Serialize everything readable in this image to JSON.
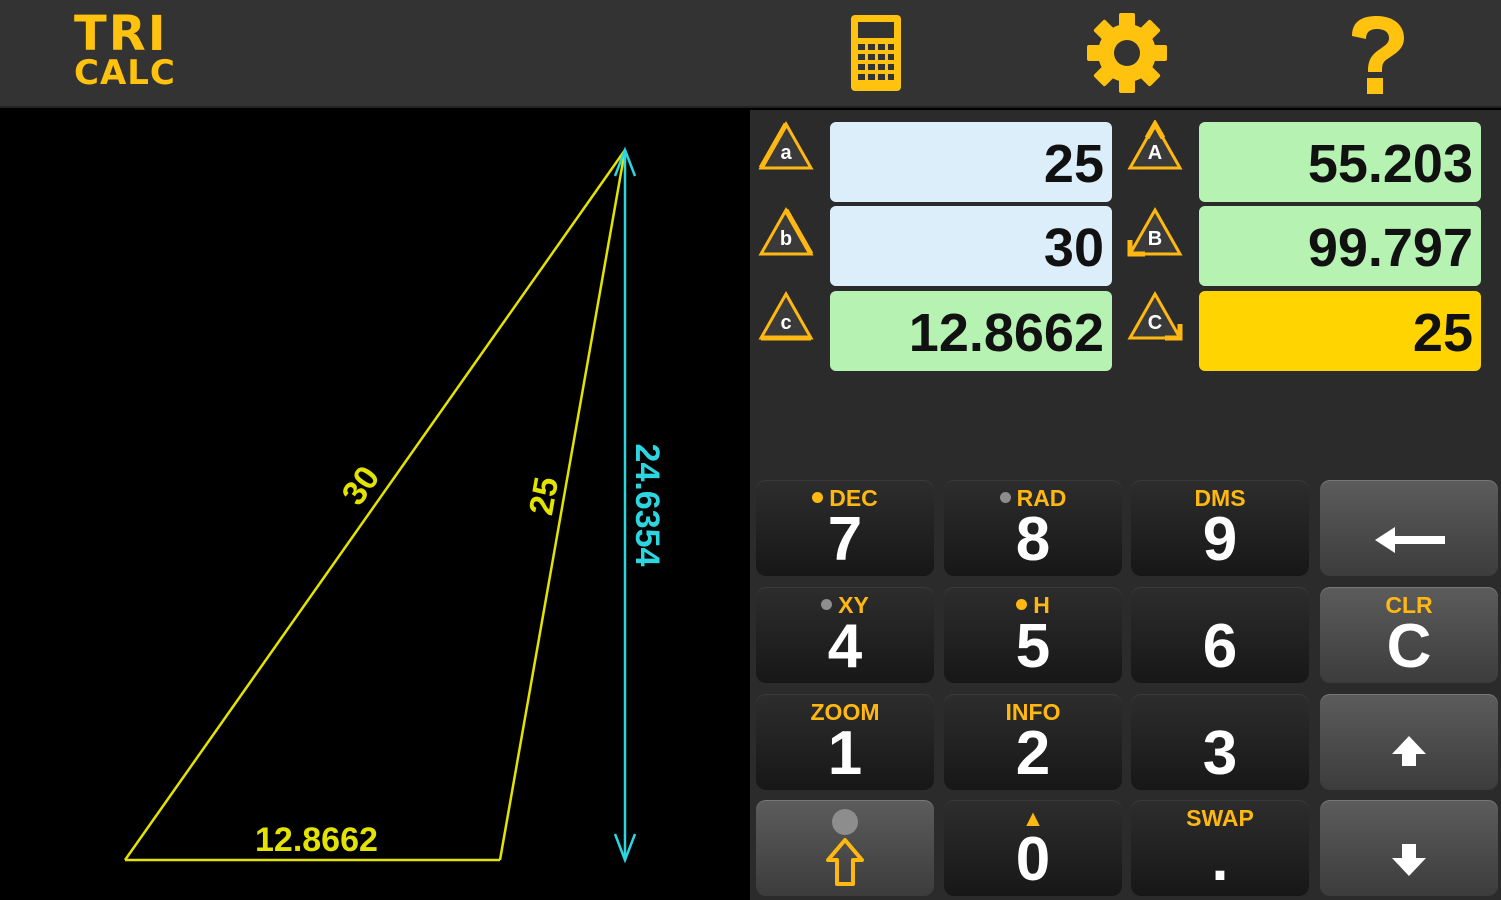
{
  "app": {
    "logo_line1": "TRI",
    "logo_line2": "CALC",
    "accent": "#FFC20E",
    "toolbar": {
      "calculator_icon": "calculator-icon",
      "settings_icon": "gear-icon",
      "help_icon": "question-mark-icon"
    }
  },
  "drawing": {
    "side_a_label": "25",
    "side_b_label": "30",
    "side_c_label": "12.8662",
    "height_label": "24.6354",
    "line_color": "#E3E300",
    "height_color": "#2BD6E0"
  },
  "fields": {
    "a": {
      "label": "a",
      "value": "25"
    },
    "b": {
      "label": "b",
      "value": "30"
    },
    "c": {
      "label": "c",
      "value": "12.8662"
    },
    "A": {
      "label": "A",
      "value": "55.203"
    },
    "B": {
      "label": "B",
      "value": "99.797"
    },
    "C": {
      "label": "C",
      "value": "25"
    },
    "colors": {
      "input": "#DCEEFA",
      "computed": "#B6F2B1",
      "selected": "#FFD400"
    }
  },
  "keypad": {
    "k7": {
      "main": "7",
      "sub": "DEC",
      "indicator": "on"
    },
    "k8": {
      "main": "8",
      "sub": "RAD",
      "indicator": "off"
    },
    "k9": {
      "main": "9",
      "sub": "DMS"
    },
    "backspace": {
      "icon": "left-arrow-icon"
    },
    "k4": {
      "main": "4",
      "sub": "XY",
      "indicator": "off"
    },
    "k5": {
      "main": "5",
      "sub": "H",
      "indicator": "on"
    },
    "k6": {
      "main": "6",
      "sub": ""
    },
    "clear": {
      "main": "C",
      "sub": "CLR"
    },
    "k1": {
      "main": "1",
      "sub": "ZOOM"
    },
    "k2": {
      "main": "2",
      "sub": "INFO"
    },
    "k3": {
      "main": "3",
      "sub": ""
    },
    "up": {
      "icon": "up-arrow-icon"
    },
    "shift": {
      "icon": "shift-arrow-icon",
      "indicator": "off"
    },
    "k0": {
      "main": "0",
      "sub": "▲"
    },
    "dot": {
      "main": ".",
      "sub": "SWAP"
    },
    "down": {
      "icon": "down-arrow-icon"
    }
  }
}
